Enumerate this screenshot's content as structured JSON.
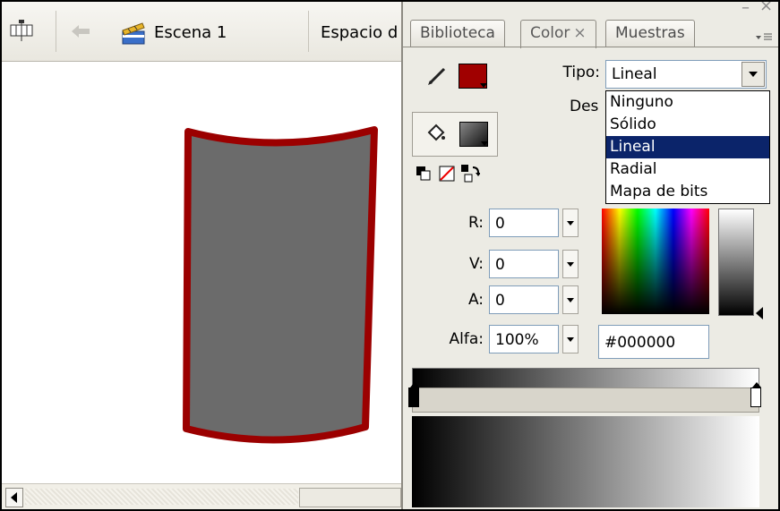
{
  "scene_bar": {
    "timeline_icon": "timeline-icon",
    "back_icon": "back-arrow-icon",
    "scene_icon": "scene-clapper-icon",
    "scene_label": "Escena 1",
    "workspace_label": "Espacio d"
  },
  "panel": {
    "tabs": [
      {
        "label": "Biblioteca"
      },
      {
        "label": "Color",
        "close": "×"
      },
      {
        "label": "Muestras"
      }
    ],
    "window_min": "–",
    "window_close": "×",
    "stroke_color": "#a00000",
    "fill_color": "#404040",
    "tipo_label": "Tipo:",
    "tipo_value": "Lineal",
    "desbordamiento_label": "Des",
    "tipo_options": [
      "Ninguno",
      "Sólido",
      "Lineal",
      "Radial",
      "Mapa de bits"
    ],
    "tipo_selected_index": 2,
    "r_label": "R:",
    "r_value": "0",
    "v_label": "V:",
    "v_value": "0",
    "a_label": "A:",
    "a_value": "0",
    "alfa_label": "Alfa:",
    "alfa_value": "100%",
    "hex_value": "#000000"
  },
  "stage": {
    "shape_fill": "#6b6b6b",
    "shape_stroke": "#9b0000"
  }
}
